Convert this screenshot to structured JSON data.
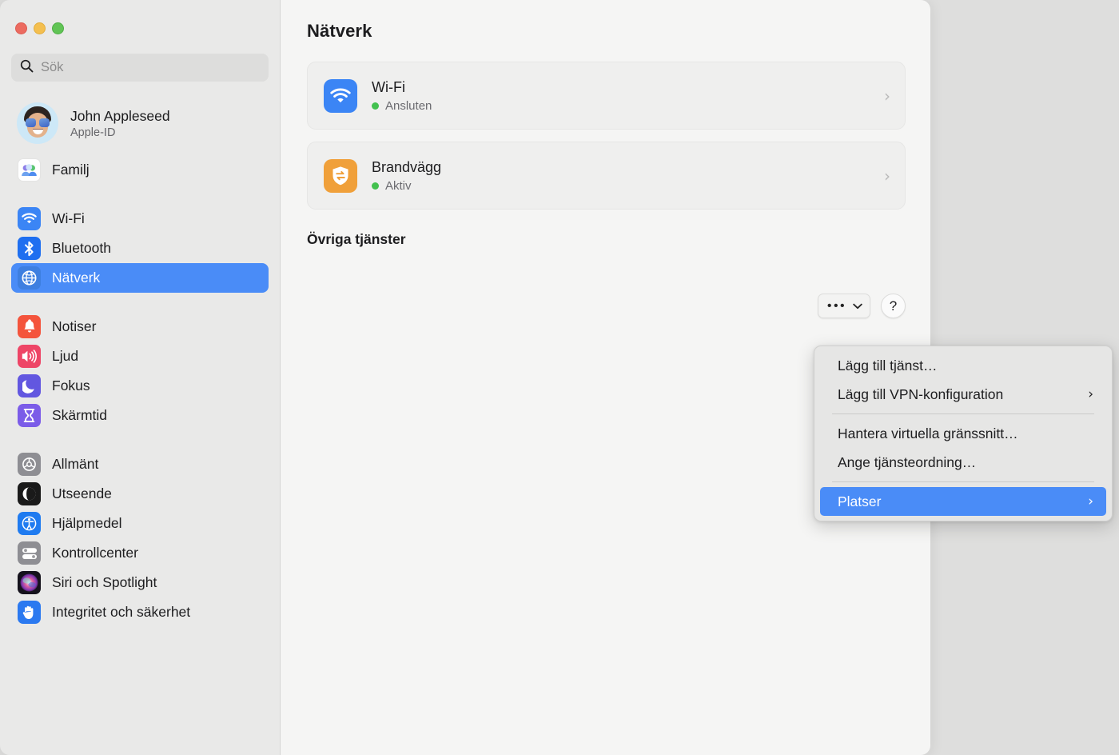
{
  "window": {
    "traffic_lights": [
      {
        "name": "close",
        "color": "#ec6b60"
      },
      {
        "name": "minimize",
        "color": "#f4bf4f"
      },
      {
        "name": "zoom",
        "color": "#61c455"
      }
    ]
  },
  "sidebar": {
    "search": {
      "placeholder": "Sök",
      "value": ""
    },
    "account": {
      "name": "John Appleseed",
      "subtitle": "Apple-ID"
    },
    "groups": [
      {
        "items": [
          {
            "label": "Familj",
            "icon": "family-icon"
          }
        ]
      },
      {
        "items": [
          {
            "label": "Wi-Fi",
            "icon": "wifi-icon",
            "selected": false
          },
          {
            "label": "Bluetooth",
            "icon": "bluetooth-icon",
            "selected": false
          },
          {
            "label": "Nätverk",
            "icon": "network-globe-icon",
            "selected": true
          }
        ]
      },
      {
        "items": [
          {
            "label": "Notiser",
            "icon": "notifications-bell-icon",
            "selected": false
          },
          {
            "label": "Ljud",
            "icon": "sound-speaker-icon",
            "selected": false
          },
          {
            "label": "Fokus",
            "icon": "focus-moon-icon",
            "selected": false
          },
          {
            "label": "Skärmtid",
            "icon": "screentime-hourglass-icon",
            "selected": false
          }
        ]
      },
      {
        "items": [
          {
            "label": "Allmänt",
            "icon": "general-gear-icon",
            "selected": false
          },
          {
            "label": "Utseende",
            "icon": "appearance-contrast-icon",
            "selected": false
          },
          {
            "label": "Hjälpmedel",
            "icon": "accessibility-icon",
            "selected": false
          },
          {
            "label": "Kontrollcenter",
            "icon": "control-center-icon",
            "selected": false
          },
          {
            "label": "Siri och Spotlight",
            "icon": "siri-icon",
            "selected": false
          },
          {
            "label": "Integritet och säkerhet",
            "icon": "privacy-hand-icon",
            "selected": false
          }
        ]
      }
    ]
  },
  "main": {
    "title": "Nätverk",
    "services": [
      {
        "name": "Wi-Fi",
        "status": "Ansluten",
        "status_color": "#43c14f",
        "icon": "wifi-icon",
        "icon_color": "#3b85f5",
        "chevron": "chevron-right-icon"
      },
      {
        "name": "Brandvägg",
        "status": "Aktiv",
        "status_color": "#43c14f",
        "icon": "firewall-shield-icon",
        "icon_color": "#f0a03a",
        "chevron": "chevron-right-icon"
      }
    ],
    "section_heading": "Övriga tjänster"
  },
  "toolbar": {
    "more_label": "•••",
    "more_chevron": "chevron-down-icon",
    "help_label": "?"
  },
  "menu": {
    "accent_color": "#4a8cf7",
    "items": [
      {
        "label": "Lägg till tjänst…",
        "submenu": false,
        "highlighted": false
      },
      {
        "label": "Lägg till VPN-konfiguration",
        "submenu": true,
        "highlighted": false
      },
      {
        "separator": true
      },
      {
        "label": "Hantera virtuella gränssnitt…",
        "submenu": false,
        "highlighted": false
      },
      {
        "label": "Ange tjänsteordning…",
        "submenu": false,
        "highlighted": false
      },
      {
        "separator": true
      },
      {
        "label": "Platser",
        "submenu": true,
        "highlighted": true
      }
    ],
    "submenu_arrow": "›"
  }
}
